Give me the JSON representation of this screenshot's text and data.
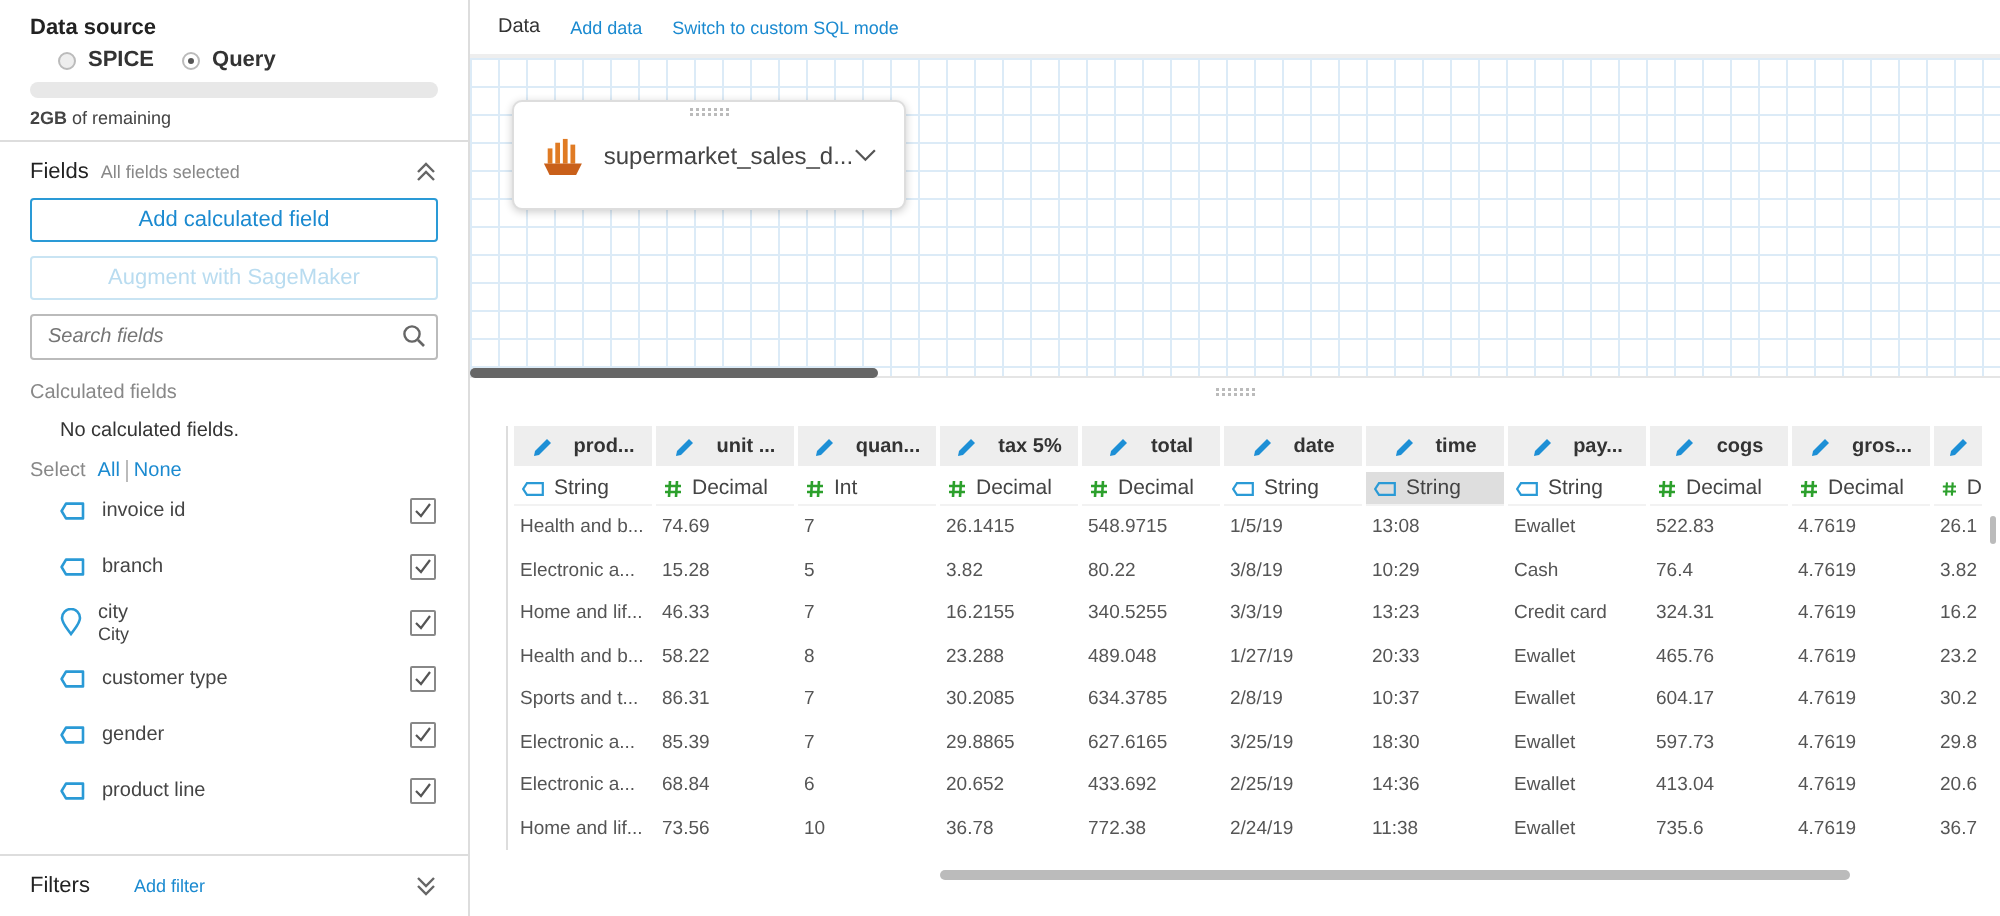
{
  "data_source": {
    "title": "Data source",
    "options": [
      {
        "label": "SPICE",
        "selected": false
      },
      {
        "label": "Query",
        "selected": true
      }
    ],
    "storage": {
      "level": 0,
      "amount": "2GB",
      "suffix": "of remaining"
    }
  },
  "fields": {
    "title": "Fields",
    "subtitle": "All fields selected",
    "expanded": true,
    "add_button": "Add calculated field",
    "augment_button": "Augment with SageMaker",
    "augment_disabled": true,
    "search_placeholder": "Search fields",
    "calculated_title": "Calculated fields",
    "calculated_empty": "No calculated fields.",
    "select_label": "Select",
    "select_all": "All",
    "select_none": "None",
    "items": [
      {
        "kind": "dimension",
        "name": "invoice id",
        "checked": true
      },
      {
        "kind": "dimension",
        "name": "branch",
        "checked": true
      },
      {
        "kind": "geo",
        "name": "city",
        "sub": "City",
        "checked": true
      },
      {
        "kind": "dimension",
        "name": "customer type",
        "checked": true
      },
      {
        "kind": "dimension",
        "name": "gender",
        "checked": true
      },
      {
        "kind": "dimension",
        "name": "product line",
        "checked": true
      }
    ]
  },
  "filters": {
    "title": "Filters",
    "add": "Add filter",
    "expanded": false
  },
  "toolbar": {
    "title": "Data",
    "links": [
      "Add data",
      "Switch to custom SQL mode"
    ]
  },
  "dataset": {
    "name": "supermarket_sales_d..."
  },
  "table": {
    "columns": [
      {
        "name": "prod...",
        "kind": "string",
        "type": "String",
        "selected": false
      },
      {
        "name": "unit ...",
        "kind": "number",
        "type": "Decimal",
        "selected": false
      },
      {
        "name": "quan...",
        "kind": "number",
        "type": "Int",
        "selected": false
      },
      {
        "name": "tax 5%",
        "kind": "number",
        "type": "Decimal",
        "selected": false
      },
      {
        "name": "total",
        "kind": "number",
        "type": "Decimal",
        "selected": false
      },
      {
        "name": "date",
        "kind": "string",
        "type": "String",
        "selected": false
      },
      {
        "name": "time",
        "kind": "string",
        "type": "String",
        "selected": true
      },
      {
        "name": "pay...",
        "kind": "string",
        "type": "String",
        "selected": false
      },
      {
        "name": "cogs",
        "kind": "number",
        "type": "Decimal",
        "selected": false
      },
      {
        "name": "gros...",
        "kind": "number",
        "type": "Decimal",
        "selected": false
      },
      {
        "kind": "number",
        "type": "D",
        "selected": false
      }
    ],
    "rows": [
      [
        "Health and b...",
        "74.69",
        "7",
        "26.1415",
        "548.9715",
        "1/5/19",
        "13:08",
        "Ewallet",
        "522.83",
        "4.7619",
        "26.1"
      ],
      [
        "Electronic a...",
        "15.28",
        "5",
        "3.82",
        "80.22",
        "3/8/19",
        "10:29",
        "Cash",
        "76.4",
        "4.7619",
        "3.82"
      ],
      [
        "Home and lif...",
        "46.33",
        "7",
        "16.2155",
        "340.5255",
        "3/3/19",
        "13:23",
        "Credit card",
        "324.31",
        "4.7619",
        "16.2"
      ],
      [
        "Health and b...",
        "58.22",
        "8",
        "23.288",
        "489.048",
        "1/27/19",
        "20:33",
        "Ewallet",
        "465.76",
        "4.7619",
        "23.2"
      ],
      [
        "Sports and t...",
        "86.31",
        "7",
        "30.2085",
        "634.3785",
        "2/8/19",
        "10:37",
        "Ewallet",
        "604.17",
        "4.7619",
        "30.2"
      ],
      [
        "Electronic a...",
        "85.39",
        "7",
        "29.8865",
        "627.6165",
        "3/25/19",
        "18:30",
        "Ewallet",
        "597.73",
        "4.7619",
        "29.8"
      ],
      [
        "Electronic a...",
        "68.84",
        "6",
        "20.652",
        "433.692",
        "2/25/19",
        "14:36",
        "Ewallet",
        "413.04",
        "4.7619",
        "20.6"
      ],
      [
        "Home and lif...",
        "73.56",
        "10",
        "36.78",
        "772.38",
        "2/24/19",
        "11:38",
        "Ewallet",
        "735.6",
        "4.7619",
        "36.7"
      ]
    ]
  }
}
